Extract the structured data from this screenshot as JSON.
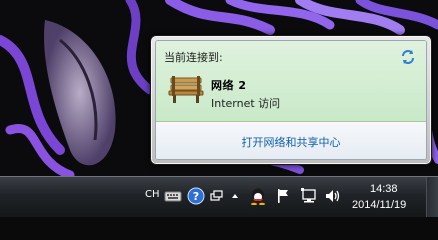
{
  "flyout": {
    "header": "当前连接到:",
    "network_name": "网络  2",
    "access_status": "Internet 访问",
    "sharing_center_link": "打开网络和共享中心",
    "icons": [
      "refresh-icon",
      "network-bench-icon"
    ]
  },
  "taskbar": {
    "language": "CH",
    "clock": {
      "time": "14:38",
      "date": "2014/11/19"
    },
    "tray_icons": [
      "keyboard-icon",
      "help-icon",
      "window-switch-icon",
      "show-hidden-icons-arrow",
      "qq-icon",
      "action-center-flag-icon",
      "network-icon",
      "volume-icon"
    ]
  },
  "colors": {
    "connected_bg": "#c9e9c8",
    "link": "#0f5ea8",
    "taskbar": "#202428"
  }
}
